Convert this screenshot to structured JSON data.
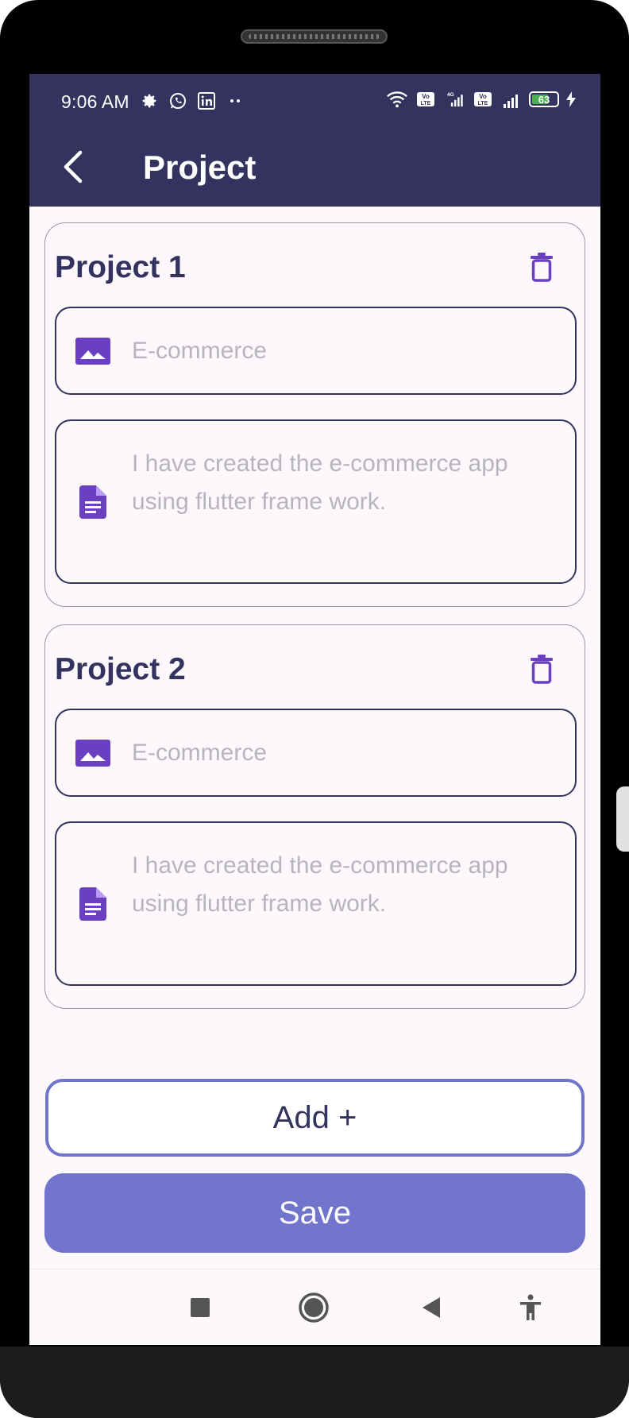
{
  "status_bar": {
    "time": "9:06 AM",
    "left_icons": [
      "gear-icon",
      "whatsapp-icon",
      "linkedin-icon",
      "more-dots-icon"
    ],
    "right_icons": [
      "wifi-icon",
      "volte-icon",
      "signal-4g-icon",
      "volte-icon",
      "signal-icon",
      "battery-icon",
      "charging-icon"
    ],
    "battery_level": "63"
  },
  "app_bar": {
    "title": "Project",
    "back_icon": "chevron-left-icon",
    "background": "#34335f"
  },
  "projects": [
    {
      "heading": "Project 1",
      "title_placeholder": "E-commerce",
      "description_placeholder": "I have created the e-commerce app using flutter frame work."
    },
    {
      "heading": "Project 2",
      "title_placeholder": "E-commerce",
      "description_placeholder": "I have created the e-commerce app using flutter frame work."
    }
  ],
  "actions": {
    "add_label": "Add +",
    "save_label": "Save"
  },
  "nav_bar": {
    "items": [
      "recents-square-icon",
      "home-circle-icon",
      "back-triangle-icon",
      "accessibility-icon"
    ]
  },
  "colors": {
    "primary": "#34335f",
    "accent": "#7175cc",
    "icon_purple": "#6a3fc0",
    "placeholder": "#b7b5bc"
  }
}
